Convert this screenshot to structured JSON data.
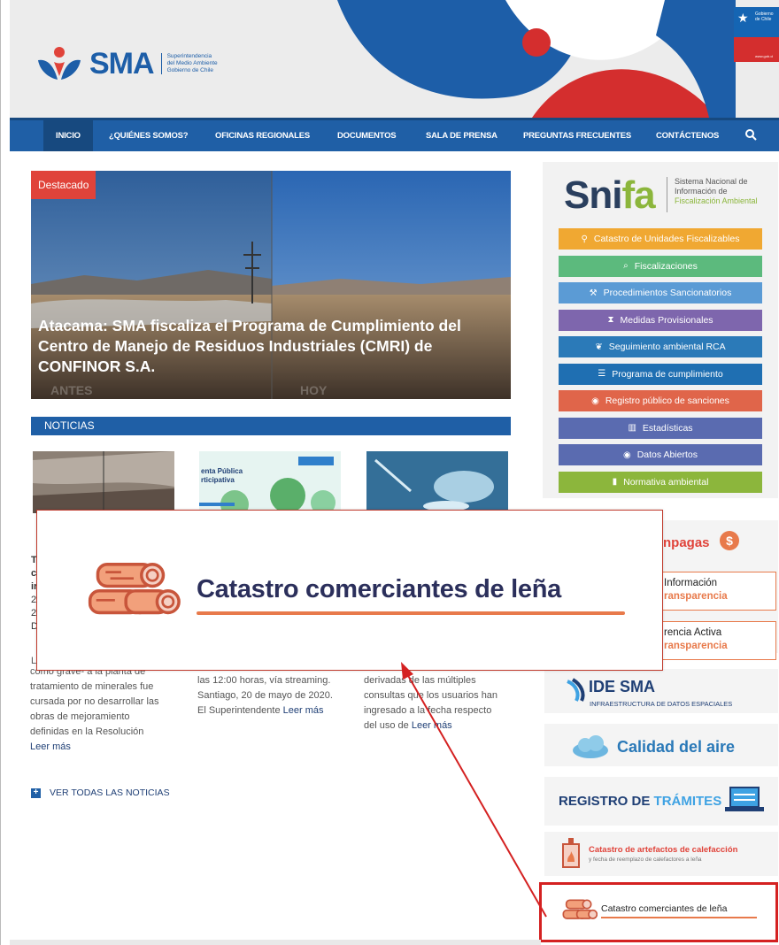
{
  "header": {
    "logo_text": "SMA",
    "logo_sub": [
      "Superintendencia",
      "del Medio Ambiente",
      "Gobierno de Chile"
    ],
    "gob_label": [
      "Gobierno",
      "de Chile"
    ],
    "gob_url": "www.gob.cl"
  },
  "nav": {
    "items": [
      "INICIO",
      "¿QUIÉNES SOMOS?",
      "OFICINAS REGIONALES",
      "DOCUMENTOS",
      "SALA DE PRENSA",
      "PREGUNTAS FRECUENTES",
      "CONTÁCTENOS"
    ],
    "search_icon": "search-icon"
  },
  "featured": {
    "badge": "Destacado",
    "title": "Atacama: SMA fiscaliza el Programa de Cumplimiento del Centro de Manejo de Residuos Industriales (CMRI) de CONFINOR S.A.",
    "ghost_left": "ANTES",
    "ghost_right": "HOY"
  },
  "news": {
    "section_title": "NOTICIAS",
    "thumb2_lines": [
      "enta Pública",
      "rticipativa"
    ],
    "col1_partial": [
      "T",
      "c",
      "ir",
      "2",
      "2",
      "D",
      "L"
    ],
    "col1_text": [
      "como grave- a la planta de",
      "tratamiento de minerales fue",
      "cursada por no desarrollar las",
      "obras de mejoramiento",
      "definidas en la Resolución"
    ],
    "col1_more": "Leer más",
    "col2_text": [
      "las 12:00 horas, vía streaming.",
      "Santiago, 20 de mayo de 2020.",
      "El Superintendente"
    ],
    "col2_more": "Leer más",
    "col3_text": [
      "derivadas de las múltiples",
      "consultas que los usuarios han",
      "ingresado a la fecha respecto",
      "del uso de"
    ],
    "col3_more": "Leer más",
    "view_all": "VER TODAS LAS NOTICIAS"
  },
  "snifa": {
    "logo_main": "Sni",
    "logo_accent": "fa",
    "sub": [
      "Sistema Nacional de",
      "Información de"
    ],
    "sub_accent": "Fiscalización Ambiental",
    "buttons": [
      {
        "label": "Catastro de Unidades Fiscalizables",
        "color": "#f0a832",
        "icon": "map-marker-icon",
        "glyph": "⚲"
      },
      {
        "label": "Fiscalizaciones",
        "color": "#5cba7d",
        "icon": "search-icon",
        "glyph": "⌕"
      },
      {
        "label": "Procedimientos Sancionatorios",
        "color": "#5b9bd5",
        "icon": "gavel-icon",
        "glyph": "⚒"
      },
      {
        "label": "Medidas Provisionales",
        "color": "#7e66ad",
        "icon": "hourglass-icon",
        "glyph": "⧗"
      },
      {
        "label": "Seguimiento ambiental RCA",
        "color": "#2b7ab8",
        "icon": "leaf-icon",
        "glyph": "❦"
      },
      {
        "label": "Programa de cumplimiento",
        "color": "#1f6fb2",
        "icon": "list-icon",
        "glyph": "☰"
      },
      {
        "label": "Registro público de sanciones",
        "color": "#e0654a",
        "icon": "eye-icon",
        "glyph": "◉"
      },
      {
        "label": "Estadísticas",
        "color": "#5a6bb0",
        "icon": "bar-chart-icon",
        "glyph": "▥"
      },
      {
        "label": "Datos Abiertos",
        "color": "#5a6bb0",
        "icon": "eye-icon",
        "glyph": "◉"
      },
      {
        "label": "Normativa ambiental",
        "color": "#8cb63c",
        "icon": "book-icon",
        "glyph": "▮"
      }
    ]
  },
  "sidebar": {
    "campaign_partial": "npagas",
    "campaign_coin": "$",
    "transp1": {
      "line1": "Información",
      "line2": "ransparencia"
    },
    "transp2": {
      "line1": "rencia Activa",
      "line2": "ransparencia"
    },
    "ide_title": "IDE SMA",
    "ide_sub": "INFRAESTRUCTURA DE DATOS ESPACIALES",
    "calidad": "Calidad del aire",
    "registro_a": "REGISTRO DE",
    "registro_b": "TRÁMITES",
    "cat_art_title": "Catastro de artefactos de calefacción",
    "cat_art_sub": "y fecha de reemplazo de calefactores a leña",
    "highlight_label": "Catastro comerciantes de leña"
  },
  "popup": {
    "title": "Catastro comerciantes de leña"
  },
  "colors": {
    "nav_blue": "#1f5fa6",
    "accent_orange": "#e87a4b",
    "highlight_red": "#d42121"
  }
}
